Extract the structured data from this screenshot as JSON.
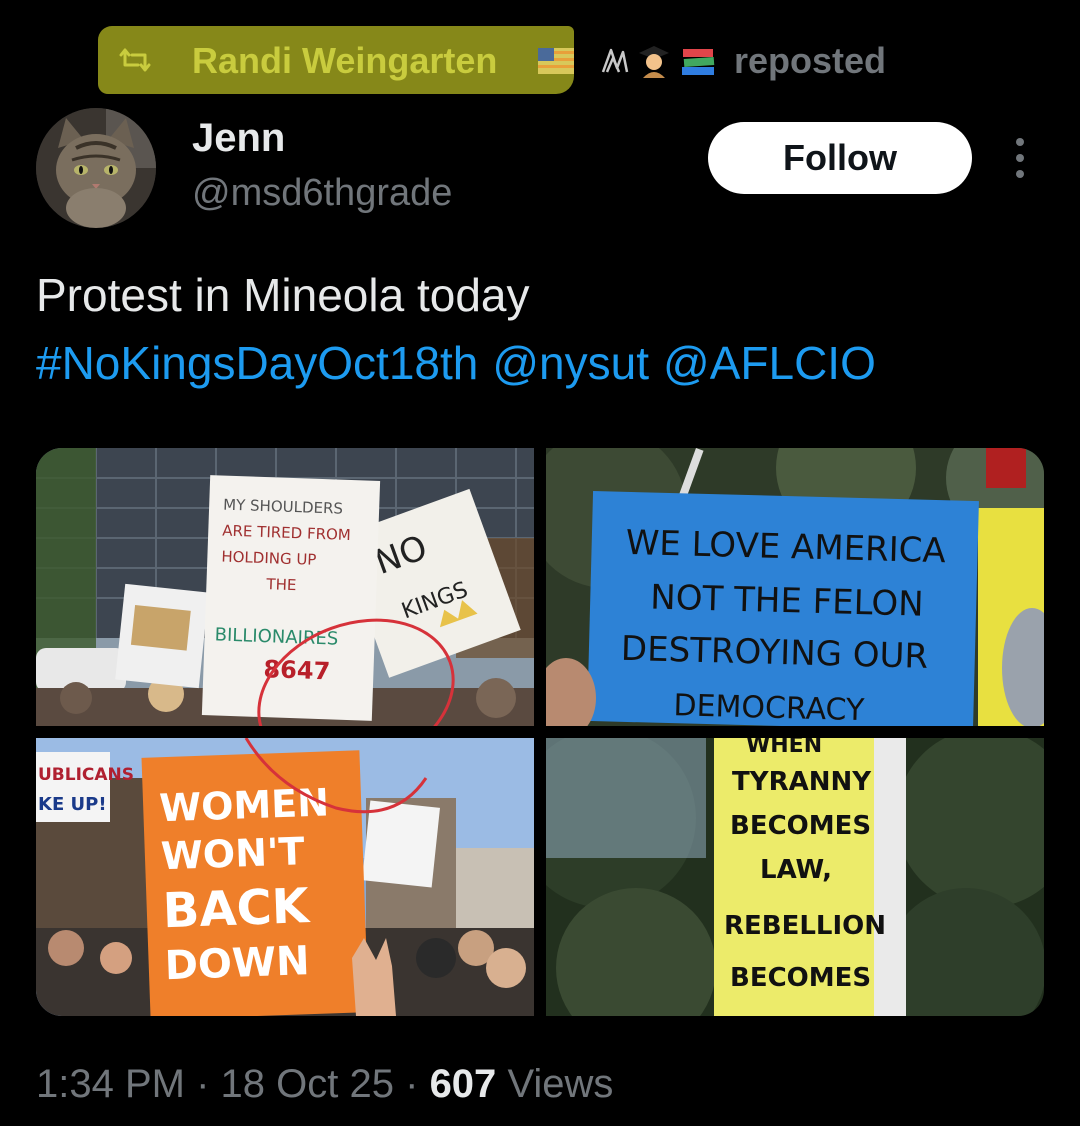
{
  "repost": {
    "name": "Randi Weingarten",
    "label": "reposted",
    "name_emojis": [
      "flag-us",
      "paperclips",
      "teacher",
      "books"
    ]
  },
  "author": {
    "name": "Jenn",
    "handle": "@msd6thgrade",
    "follow_label": "Follow"
  },
  "tweet": {
    "text": "Protest in Mineola today",
    "hashtag": "#NoKingsDayOct18th",
    "mentions": [
      "@nysut",
      "@AFLCIO"
    ]
  },
  "photos": [
    {
      "sign_lines": [
        "MY SHOULDERS",
        "ARE TIRED FROM",
        "HOLDING UP",
        "THE",
        "BILLIONAIRES",
        "8647"
      ],
      "second_sign": [
        "NO",
        "KINGS"
      ]
    },
    {
      "sign_lines": [
        "WE LOVE AMERICA",
        "NOT THE FELON",
        "DESTROYING OUR",
        "DEMOCRACY"
      ]
    },
    {
      "sign_lines": [
        "WOMEN",
        "WON'T",
        "BACK",
        "DOWN"
      ],
      "side_sign": [
        "UBLICANS",
        "KE UP!"
      ]
    },
    {
      "sign_lines": [
        "WHEN",
        "TYRANNY",
        "BECOMES",
        "LAW,",
        "REBELLION",
        "BECOMES"
      ]
    }
  ],
  "meta": {
    "time": "1:34 PM",
    "separator": "·",
    "date": "18 Oct 25",
    "views_count": "607",
    "views_label": "Views"
  },
  "colors": {
    "background": "#000000",
    "text": "#e7e9ea",
    "muted": "#71767b",
    "link": "#1d9bf0",
    "highlight": "#8d8f1a"
  }
}
